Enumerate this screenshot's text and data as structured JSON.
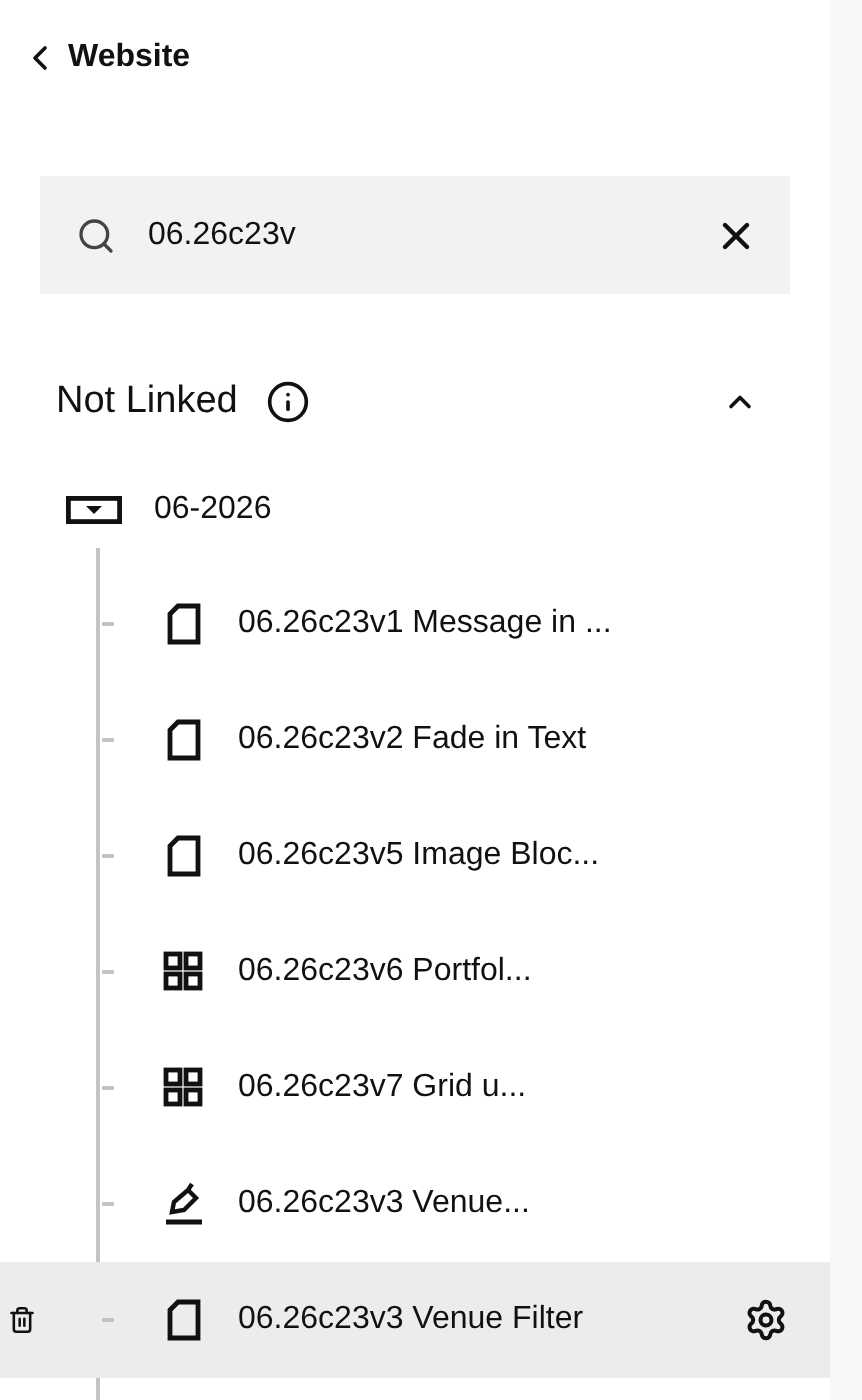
{
  "back": {
    "label": "Website"
  },
  "search": {
    "value": "06.26c23v"
  },
  "section": {
    "title": "Not Linked",
    "expanded": true
  },
  "folder": {
    "label": "06-2026"
  },
  "items": [
    {
      "kind": "page",
      "label": "06.26c23v1 Message in ...",
      "selected": false
    },
    {
      "kind": "page",
      "label": "06.26c23v2 Fade in Text",
      "selected": false
    },
    {
      "kind": "page",
      "label": "06.26c23v5 Image Bloc...",
      "selected": false
    },
    {
      "kind": "grid",
      "label": "06.26c23v6 Portfol...",
      "selected": false
    },
    {
      "kind": "grid",
      "label": "06.26c23v7 Grid u...",
      "selected": false
    },
    {
      "kind": "pen",
      "label": "06.26c23v3 Venue...",
      "selected": false
    },
    {
      "kind": "page",
      "label": "06.26c23v3 Venue Filter",
      "selected": true
    }
  ]
}
